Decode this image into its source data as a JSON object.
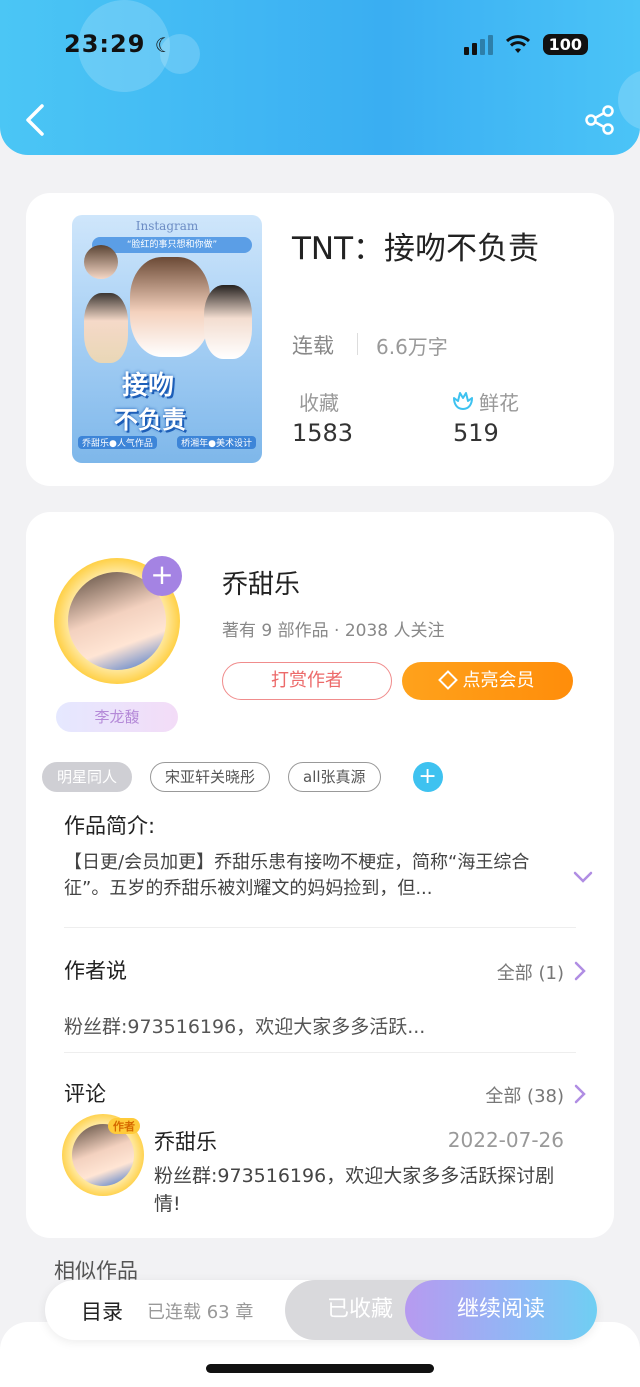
{
  "status_bar": {
    "time": "23:29",
    "battery": "100"
  },
  "book": {
    "title": "TNT：接吻不负责",
    "status": "连载",
    "word_count": "6.6万字",
    "collect_label": "收藏",
    "collect_count": "1583",
    "flower_label": "鲜花",
    "flower_count": "519",
    "cover": {
      "app": "Instagram",
      "banner": "“脸红的事只想和你做”",
      "title_line1": "接吻",
      "title_line2": "不负责",
      "foot_left": "乔甜乐●人气作品",
      "foot_right": "桥湘年●美术设计"
    }
  },
  "author": {
    "name": "乔甜乐",
    "meta": "著有 9 部作品 · 2038 人关注",
    "fan_tag": "李龙馥",
    "tip_button": "打赏作者",
    "vip_button": "点亮会员",
    "tags": [
      "明星同人",
      "宋亚轩关晓彤",
      "all张真源"
    ]
  },
  "intro": {
    "title": "作品简介:",
    "text": "【日更/会员加更】乔甜乐患有接吻不梗症，简称“海王综合征”。五岁的乔甜乐被刘耀文的妈妈捡到，但..."
  },
  "author_says": {
    "title": "作者说",
    "all_link": "全部 (1)",
    "text": "粉丝群:973516196，欢迎大家多多活跃..."
  },
  "comments": {
    "title": "评论",
    "all_link": "全部 (38)",
    "item": {
      "badge": "作者",
      "name": "乔甜乐",
      "date": "2022-07-26",
      "text": "粉丝群:973516196，欢迎大家多多活跃探讨剧情!"
    }
  },
  "similar_title": "相似作品",
  "bottom_bar": {
    "toc": "目录",
    "chapters": "已连载 63 章",
    "collected": "已收藏",
    "continue": "继续阅读"
  },
  "colors": {
    "header": "#3aaef2",
    "accent_orange": "#ff9512",
    "accent_purple": "#a483e3",
    "accent_blue": "#3ec2f0"
  }
}
